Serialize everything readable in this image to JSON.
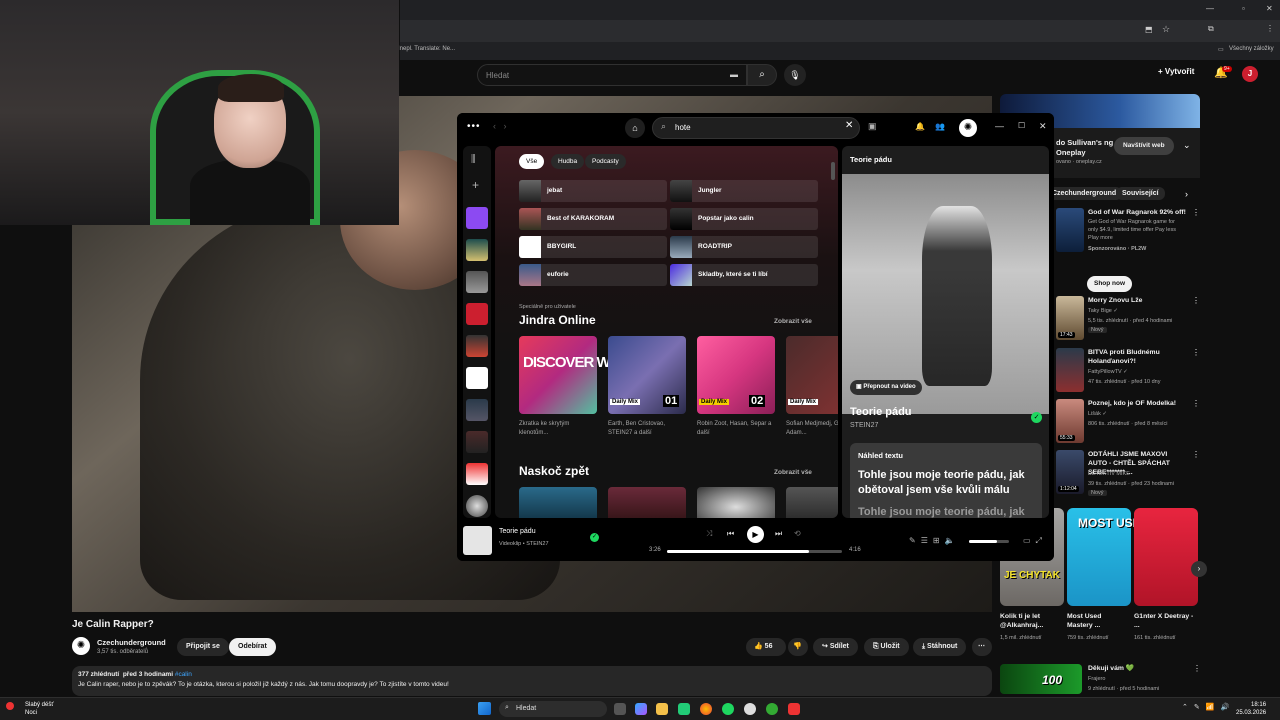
{
  "browser": {
    "bookmarks_partial": "Inepl. Translate: Ne...",
    "all_bookmarks": "Všechny záložky"
  },
  "youtube": {
    "search_placeholder": "Hledat",
    "create_label": "Vytvořit",
    "notifications_badge": "9+",
    "avatar_letter": "J",
    "video_title": "Je Calin Rapper?",
    "channel_name": "Czechunderground",
    "channel_subs": "3,57 tis. odběratelů",
    "join_label": "Připojit se",
    "subscribe_label": "Odebírat",
    "likes": "56",
    "share_label": "Sdílet",
    "save_label": "Uložit",
    "download_label": "Stáhnout",
    "desc_views": "377 zhlédnutí",
    "desc_time": "před 3 hodinami",
    "desc_tag": "#calin",
    "desc_text": "Je Calin raper, nebo je to zpěvák? To je otázka, kterou si položil již každý z nás. Jak tomu doopravdy je? To zjistíte v tomto videu!",
    "ad": {
      "title": "do Sullivan's ng na Oneplay",
      "sponsor": "ovano · oneplay.cz",
      "visit_label": "Navštívit web"
    },
    "chips": [
      "Czechunderground",
      "Související"
    ],
    "recommendations": [
      {
        "title": "God of War Ragnarok 92% off!",
        "channel": "Get God of War Ragnarok game for only $4.9, limited time offer Pay less Play more",
        "meta": "Sponzorováno · PL2W",
        "duration": "",
        "cta": "Shop now"
      },
      {
        "title": "Morry Znovu Lže",
        "channel": "Taky Bige ✓",
        "meta": "5,5 tis. zhlédnutí · před 4 hodinami",
        "duration": "17:43",
        "badge": "Nový"
      },
      {
        "title": "BITVA proti Bludnému Holanďanovi?!",
        "channel": "FattyPillowTV ✓",
        "meta": "47 tis. zhlédnutí · před 10 dny",
        "duration": "",
        "badge": ""
      },
      {
        "title": "Poznej, kdo je OF Modelka!",
        "channel": "Lišák ✓",
        "meta": "806 tis. zhlédnutí · před 8 měsíci",
        "duration": "55:33",
        "badge": ""
      },
      {
        "title": "ODTÁHLI JSME MAXOVI AUTO - CHTĚL SPÁCHAT SEBE******* ...",
        "channel": "DETEKTIV MIKE",
        "meta": "39 tis. zhlédnutí · před 23 hodinami",
        "duration": "1:12:04",
        "badge": "Nový"
      }
    ],
    "shorts": [
      {
        "title": "Kolik ti je let @Alkanhraj...",
        "meta": "1,5 mil. zhlédnutí",
        "overlay": "JE CHYTAK"
      },
      {
        "title": "Most Used Mastery ...",
        "meta": "759 tis. zhlédnutí",
        "overlay": "MOST USED"
      },
      {
        "title": "G1nter X Deetray - ...",
        "meta": "161 tis. zhlédnutí",
        "overlay": ""
      }
    ],
    "last_reco": {
      "title": "Děkuji vám 💚",
      "channel": "Frajero",
      "meta": "9 zhlédnutí · před 5 hodinami",
      "overlay": "100"
    }
  },
  "spotify": {
    "search_value": "hote",
    "chips": [
      "Vše",
      "Hudba",
      "Podcasty"
    ],
    "quick": [
      "jebat",
      "Jungler",
      "Best of KARAKORAM",
      "Popstar jako calin",
      "BBYGIRL",
      "ROADTRIP",
      "euforie",
      "Skladby, které se ti líbí"
    ],
    "made_for_label": "Speciálně pro uživatele",
    "made_for_user": "Jindra Online",
    "show_all": "Zobrazit vše",
    "cards": [
      {
        "cover": "DISCOVER WEEKLY",
        "sub": "Zkratka ke skrytým klenotům..."
      },
      {
        "cover_label": "Daily Mix",
        "cover_num": "01",
        "sub": "Earth, Ben Cristovao, STEIN27 a další"
      },
      {
        "cover_label": "Daily Mix",
        "cover_num": "02",
        "sub": "Robin Zoot, Hasan, Separ a další"
      },
      {
        "cover_label": "Daily Mix",
        "cover_num": "03",
        "sub": "Sofian Medjmedj, GUFRAU, Adam..."
      }
    ],
    "jump_back": "Naskoč zpět",
    "now_playing": {
      "header": "Teorie pádu",
      "switch_video": "Přepnout na video",
      "title": "Teorie pádu",
      "artist": "STEIN27",
      "lyrics_header": "Náhled textu",
      "lyrics_line1": "Tohle jsou moje teorie pádu, jak obětoval jsem vše kvůli málu",
      "lyrics_line2": "Tohle jsou moje teorie pádu, jak"
    },
    "player": {
      "title": "Teorie pádu",
      "sub": "Videoklip • STEIN27",
      "elapsed": "3:26",
      "total": "4:16",
      "progress": 0.81,
      "volume": 0.7
    }
  },
  "taskbar": {
    "weather_line1": "Slabý déšť",
    "weather_line2": "Noci",
    "search_label": "Hledat",
    "time": "18:16",
    "date": "25.03.2026"
  },
  "colors": {
    "spotify_green": "#1ed760",
    "youtube_red": "#cc0000"
  }
}
